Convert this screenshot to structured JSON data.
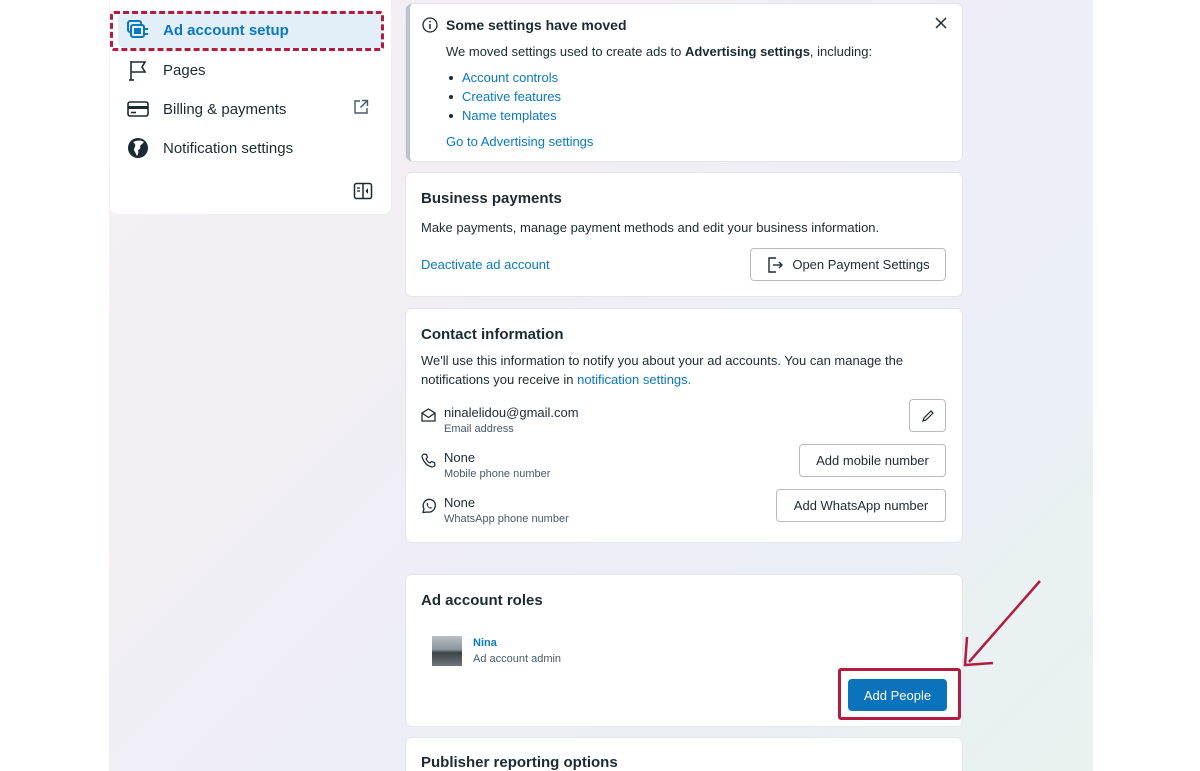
{
  "sidebar": {
    "items": [
      {
        "label": "Ad account setup",
        "icon": "ad-account-icon"
      },
      {
        "label": "Pages",
        "icon": "flag-icon"
      },
      {
        "label": "Billing & payments",
        "icon": "credit-card-icon"
      },
      {
        "label": "Notification settings",
        "icon": "globe-icon"
      }
    ]
  },
  "notice": {
    "title": "Some settings have moved",
    "desc_prefix": "We moved settings used to create ads to ",
    "desc_bold": "Advertising settings",
    "desc_suffix": ", including:",
    "items": [
      "Account controls",
      "Creative features",
      "Name templates"
    ],
    "link": "Go to Advertising settings"
  },
  "business_payments": {
    "title": "Business payments",
    "desc": "Make payments, manage payment methods and edit your business information.",
    "deactivate_link": "Deactivate ad account",
    "open_button": "Open Payment Settings"
  },
  "contact": {
    "title": "Contact information",
    "desc_prefix": "We'll use this information to notify you about your ad accounts. You can manage the notifications you receive in ",
    "desc_link": "notification settings.",
    "email": {
      "value": "ninalelidou@gmail.com",
      "label": "Email address"
    },
    "mobile": {
      "value": "None",
      "label": "Mobile phone number",
      "button": "Add mobile number"
    },
    "whatsapp": {
      "value": "None",
      "label": "WhatsApp phone number",
      "button": "Add WhatsApp number"
    }
  },
  "roles": {
    "title": "Ad account roles",
    "person": {
      "name": "Nina",
      "role": "Ad account admin"
    },
    "add_button": "Add People"
  },
  "publisher": {
    "title": "Publisher reporting options"
  },
  "colors": {
    "accent": "#0a78be",
    "primary_button": "#0a73bc",
    "highlight": "#b31b3f"
  }
}
